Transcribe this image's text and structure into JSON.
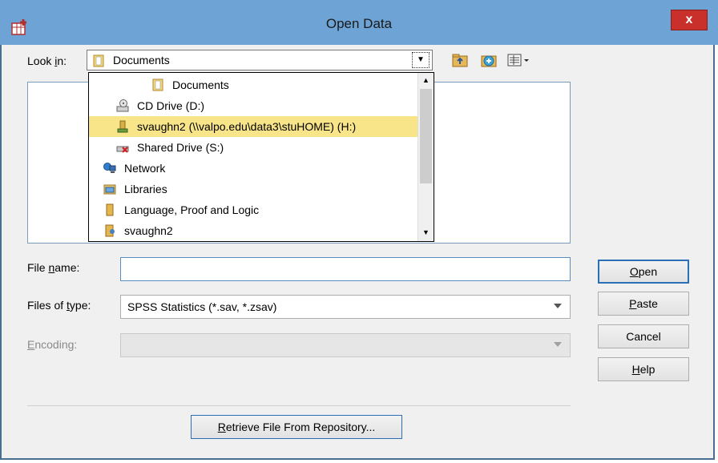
{
  "window": {
    "title": "Open Data",
    "close_label": "x",
    "accent": "#6ea3d5",
    "close_color": "#c9302c"
  },
  "look_in": {
    "label_prefix": "Look ",
    "label_accel": "i",
    "label_suffix": "n:",
    "value": "Documents"
  },
  "dropdown": {
    "items": [
      {
        "label": "Documents",
        "icon": "documents-folder-icon"
      },
      {
        "label": "CD Drive (D:)",
        "icon": "cd-drive-icon"
      },
      {
        "label": "svaughn2 (\\\\valpo.edu\\data3\\stuHOME) (H:)",
        "icon": "network-drive-icon",
        "selected": true
      },
      {
        "label": "Shared Drive (S:)",
        "icon": "disconnected-drive-icon"
      },
      {
        "label": "Network",
        "icon": "network-icon"
      },
      {
        "label": "Libraries",
        "icon": "libraries-icon"
      },
      {
        "label": "Language, Proof and Logic",
        "icon": "folder-icon"
      },
      {
        "label": "svaughn2",
        "icon": "user-folder-icon"
      }
    ],
    "selected_color": "#f8e58a"
  },
  "form": {
    "filename_label_prefix": "File ",
    "filename_label_accel": "n",
    "filename_label_suffix": "ame:",
    "filename_value": "",
    "filetype_label_prefix": "Files of ",
    "filetype_label_accel": "t",
    "filetype_label_suffix": "ype:",
    "filetype_value": "SPSS Statistics (*.sav, *.zsav)",
    "encoding_label_accel": "E",
    "encoding_label_suffix": "ncoding:",
    "encoding_value": ""
  },
  "buttons": {
    "open_accel": "O",
    "open_rest": "pen",
    "paste_accel": "P",
    "paste_rest": "aste",
    "cancel": "Cancel",
    "help_accel": "H",
    "help_rest": "elp",
    "retrieve_accel": "R",
    "retrieve_rest": "etrieve File From Repository..."
  }
}
